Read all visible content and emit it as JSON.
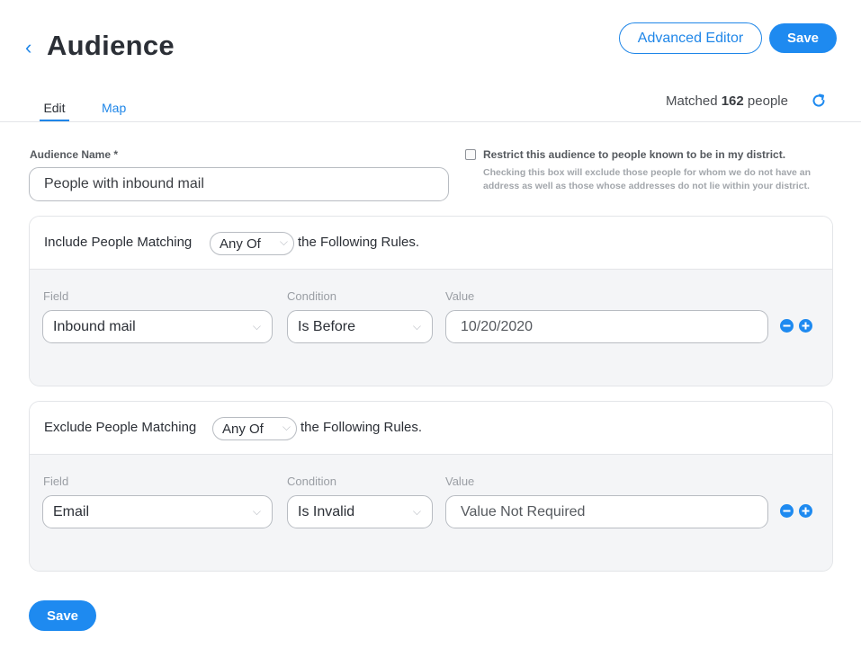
{
  "header": {
    "title": "Audience",
    "advanced_editor_label": "Advanced Editor",
    "save_label": "Save"
  },
  "tabs": [
    {
      "label": "Edit",
      "active": true
    },
    {
      "label": "Map",
      "active": false
    }
  ],
  "matched": {
    "prefix": "Matched",
    "count": "162",
    "suffix": "people"
  },
  "audience_name": {
    "label": "Audience Name *",
    "value": "People with inbound mail"
  },
  "restrict": {
    "checked": false,
    "label": "Restrict this audience to people known to be in my district.",
    "help": "Checking this box will exclude those people for whom we do not have an address as well as those whose addresses do not lie within your district."
  },
  "include": {
    "prefix": "Include People Matching",
    "mode": "Any Of",
    "suffix": "the Following Rules.",
    "columns": {
      "field": "Field",
      "condition": "Condition",
      "value": "Value"
    },
    "rule": {
      "field": "Inbound mail",
      "condition": "Is Before",
      "value": "10/20/2020"
    }
  },
  "exclude": {
    "prefix": "Exclude People Matching",
    "mode": "Any Of",
    "suffix": "the Following Rules.",
    "columns": {
      "field": "Field",
      "condition": "Condition",
      "value": "Value"
    },
    "rule": {
      "field": "Email",
      "condition": "Is Invalid",
      "value": "Value Not Required"
    }
  },
  "footer": {
    "save_label": "Save"
  },
  "colors": {
    "accent": "#1e8af0",
    "border": "#b8bcc2",
    "panel": "#f4f5f7"
  }
}
